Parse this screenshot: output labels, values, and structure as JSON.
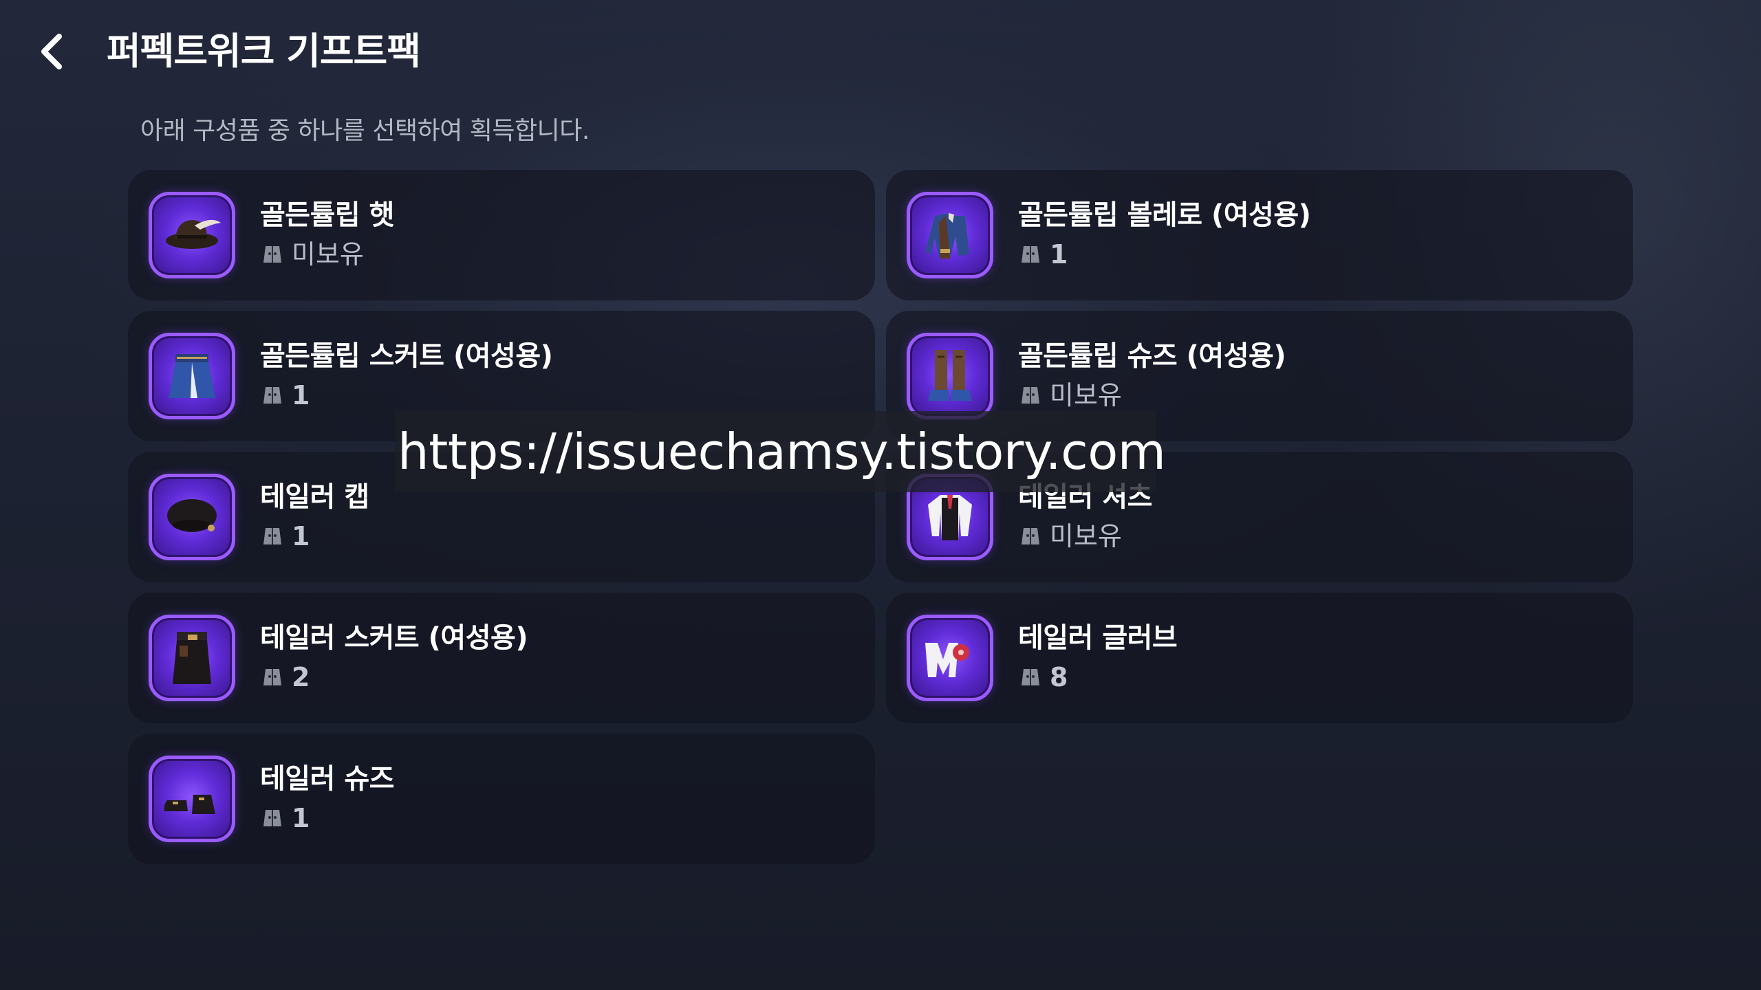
{
  "header": {
    "title": "퍼펙트위크 기프트팩",
    "subtitle": "아래 구성품 중 하나를 선택하여 획득합니다."
  },
  "watermark": "https://issuechamsy.tistory.com",
  "items": [
    {
      "name": "골든튤립 햇",
      "owned": "미보유",
      "icon": "hat-icon"
    },
    {
      "name": "골든튤립 볼레로 (여성용)",
      "owned": "1",
      "icon": "bolero-icon"
    },
    {
      "name": "골든튤립 스커트 (여성용)",
      "owned": "1",
      "icon": "skirt-icon"
    },
    {
      "name": "골든튤립 슈즈 (여성용)",
      "owned": "미보유",
      "icon": "boots-icon"
    },
    {
      "name": "테일러 캡",
      "owned": "1",
      "icon": "cap-icon"
    },
    {
      "name": "테일러 셔츠",
      "owned": "미보유",
      "icon": "shirt-icon"
    },
    {
      "name": "테일러 스커트 (여성용)",
      "owned": "2",
      "icon": "long-skirt-icon"
    },
    {
      "name": "테일러 글러브",
      "owned": "8",
      "icon": "glove-icon"
    },
    {
      "name": "테일러 슈즈",
      "owned": "1",
      "icon": "shoes-icon"
    }
  ],
  "colors": {
    "frame_border": "#9a5bff",
    "frame_fill": "#5f2bd6",
    "card_bg": "#12141e",
    "subtitle_text": "#b4b8c4"
  }
}
